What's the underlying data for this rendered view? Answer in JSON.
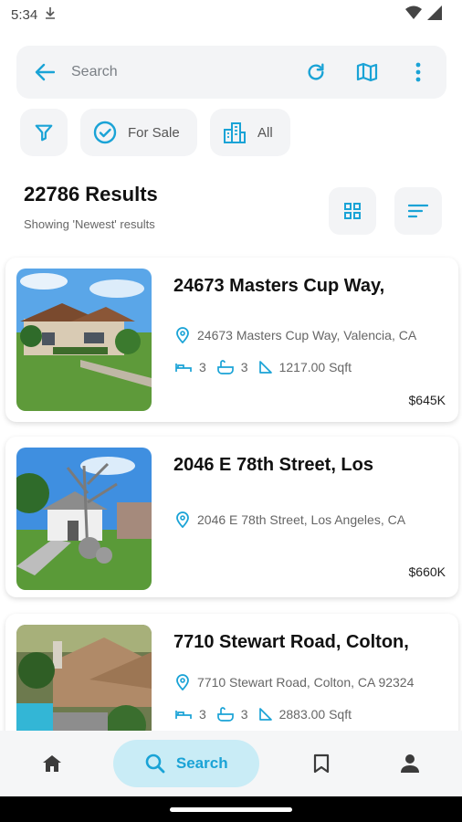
{
  "status": {
    "time": "5:34"
  },
  "search": {
    "placeholder": "Search"
  },
  "chips": {
    "for_sale": "For Sale",
    "all": "All"
  },
  "results": {
    "count": "22786 Results",
    "subtitle": "Showing 'Newest' results"
  },
  "listings": [
    {
      "title": "24673 Masters Cup Way,",
      "address": "24673 Masters Cup Way, Valencia, CA",
      "beds": "3",
      "baths": "3",
      "sqft": "1217.00 Sqft",
      "price": "$645K"
    },
    {
      "title": "2046 E 78th Street, Los",
      "address": "2046 E 78th Street, Los Angeles, CA",
      "price": "$660K"
    },
    {
      "title": "7710 Stewart Road, Colton,",
      "address": "7710 Stewart Road, Colton, CA 92324",
      "beds": "3",
      "baths": "3",
      "sqft": "2883.00 Sqft"
    }
  ],
  "nav": {
    "search_label": "Search"
  },
  "colors": {
    "accent": "#1aa3d6",
    "chip_bg": "#f3f4f6",
    "active_nav": "#c9ecf6"
  }
}
